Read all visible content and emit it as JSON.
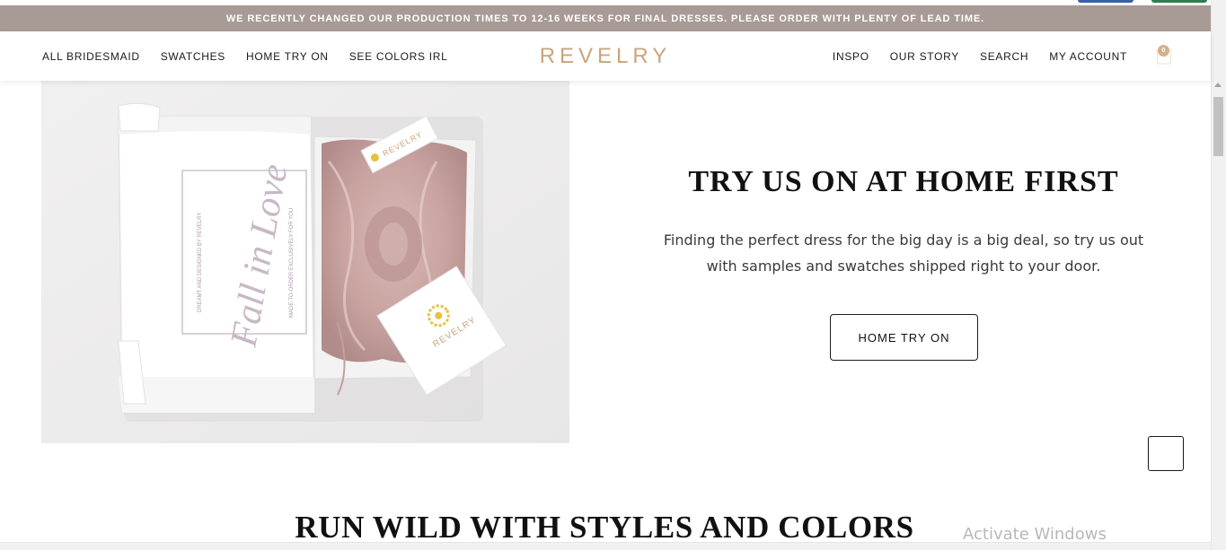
{
  "announcement": {
    "text": "WE RECENTLY CHANGED OUR PRODUCTION TIMES TO 12-16 WEEKS FOR FINAL DRESSES. PLEASE ORDER WITH PLENTY OF LEAD TIME."
  },
  "header": {
    "logo": "REVELRY",
    "nav_left": [
      {
        "label": "ALL BRIDESMAID"
      },
      {
        "label": "SWATCHES"
      },
      {
        "label": "HOME TRY ON"
      },
      {
        "label": "SEE COLORS IRL"
      }
    ],
    "nav_right": [
      {
        "label": "INSPO"
      },
      {
        "label": "OUR STORY"
      },
      {
        "label": "SEARCH"
      },
      {
        "label": "MY ACCOUNT"
      }
    ],
    "cart": {
      "count": "0",
      "icon": "shopping-bag-icon"
    }
  },
  "hero_image": {
    "box_text_left": "DREAMT AND DESIGNED BY REVELRY",
    "box_script": "Fall in Love",
    "box_text_right": "MADE-TO-ORDER EXCLUSIVELY FOR YOU",
    "tag_text": "REVELRY",
    "card_text": "REVELRY"
  },
  "promo": {
    "title": "TRY US ON AT HOME FIRST",
    "text_line1": "Finding the perfect dress for the big day is a big deal, so try us out",
    "text_line2": "with samples and swatches shipped right to your door.",
    "button_label": "HOME TRY ON"
  },
  "section": {
    "title": "RUN WILD WITH STYLES AND COLORS"
  },
  "system": {
    "watermark": "Activate Windows"
  },
  "colors": {
    "announcement_bg": "#a89a95",
    "logo": "#c9a57c",
    "dress": "#c9a3a0"
  }
}
